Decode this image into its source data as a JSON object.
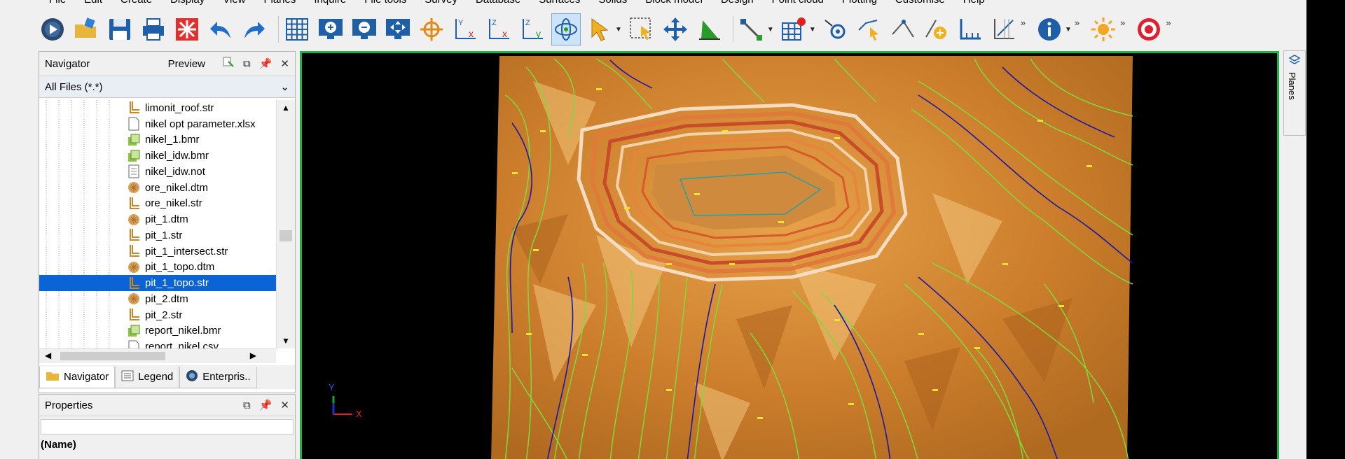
{
  "menu": [
    "File",
    "Edit",
    "Create",
    "Display",
    "View",
    "Planes",
    "Inquire",
    "File tools",
    "Survey",
    "Database",
    "Surfaces",
    "Solids",
    "Block model",
    "Design",
    "Point cloud",
    "Plotting",
    "Customise",
    "Help"
  ],
  "toolbar": {
    "items": [
      "new-file-icon",
      "open-folder-icon",
      "save-icon",
      "print-icon",
      "red-star-icon",
      "undo-icon",
      "redo-icon",
      "grid-icon",
      "zoom-in-icon",
      "zoom-out-icon",
      "pan-icon",
      "target-icon",
      "yx-plane-icon",
      "zx-plane-icon",
      "zy-plane-icon",
      "rotate-icon",
      "select-arrow-icon",
      "box-select-icon",
      "move-icon",
      "triangle-icon",
      "snap-icon",
      "grid-red-icon",
      "settings-icon",
      "pick-icon",
      "angle-icon",
      "add-point-icon",
      "measure-icon",
      "section-icon",
      "info-icon",
      "sun-icon",
      "target-logo-icon"
    ],
    "more": "»"
  },
  "navigator": {
    "title": "Navigator",
    "preview": "Preview",
    "filter": "All Files (*.*)",
    "files": [
      {
        "name": "limonit_roof.str",
        "type": "str"
      },
      {
        "name": "nikel opt parameter.xlsx",
        "type": "doc"
      },
      {
        "name": "nikel_1.bmr",
        "type": "bmr"
      },
      {
        "name": "nikel_idw.bmr",
        "type": "bmr"
      },
      {
        "name": "nikel_idw.not",
        "type": "not"
      },
      {
        "name": "ore_nikel.dtm",
        "type": "dtm"
      },
      {
        "name": "ore_nikel.str",
        "type": "str"
      },
      {
        "name": "pit_1.dtm",
        "type": "dtm"
      },
      {
        "name": "pit_1.str",
        "type": "str"
      },
      {
        "name": "pit_1_intersect.str",
        "type": "str"
      },
      {
        "name": "pit_1_topo.dtm",
        "type": "dtm"
      },
      {
        "name": "pit_1_topo.str",
        "type": "str",
        "selected": true
      },
      {
        "name": "pit_2.dtm",
        "type": "dtm"
      },
      {
        "name": "pit_2.str",
        "type": "str"
      },
      {
        "name": "report_nikel.bmr",
        "type": "bmr"
      },
      {
        "name": "report_nikel.csv",
        "type": "doc"
      }
    ],
    "tabs": [
      "Navigator",
      "Legend",
      "Enterpris.."
    ]
  },
  "properties": {
    "title": "Properties",
    "name_label": "(Name)"
  },
  "viewport": {
    "axis_y": "Y",
    "axis_x": "X",
    "planes_tab": "Planes"
  },
  "colors": {
    "selection": "#0a64d6",
    "viewport_border": "#21b04b",
    "terrain": "#d98c33",
    "contour_green": "#7cdc3a",
    "contour_blue": "#1a1aa0"
  }
}
